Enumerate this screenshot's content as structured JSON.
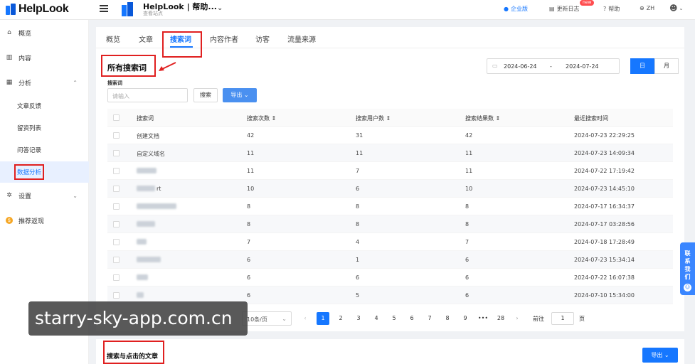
{
  "topbar": {
    "logo_text": "HelpLook",
    "site_title": "HelpLook | 帮助...",
    "site_subtitle": "查看站点",
    "enterprise": "企业版",
    "changelog": "更新日志",
    "new_badge": "new",
    "help": "帮助",
    "language": "ZH"
  },
  "sidebar": {
    "items": [
      {
        "label": "概览",
        "icon": "home-icon"
      },
      {
        "label": "内容",
        "icon": "book-icon"
      },
      {
        "label": "分析",
        "icon": "chart-icon"
      },
      {
        "label": "设置",
        "icon": "gear-icon"
      },
      {
        "label": "推荐返现",
        "icon": "coin-icon"
      }
    ],
    "sub_items": [
      "文章反馈",
      "留资列表",
      "问答记录",
      "数据分析"
    ]
  },
  "tabs": [
    "概览",
    "文章",
    "搜索词",
    "内容作者",
    "访客",
    "流量来源"
  ],
  "section": {
    "title": "所有搜索词",
    "date_start": "2024-06-24",
    "date_sep": "-",
    "date_end": "2024-07-24",
    "range_day": "日",
    "range_month": "月",
    "filter_label": "搜索词",
    "search_placeholder": "请输入",
    "search_button": "搜索",
    "export_button": "导出 ⌄"
  },
  "table": {
    "headers": [
      "搜索词",
      "搜索次数 ⇕",
      "搜索用户数 ⇕",
      "搜索结果数 ⇕",
      "最近搜索时间"
    ],
    "rows": [
      {
        "term": "创建文档",
        "count": "42",
        "users": "31",
        "results": "42",
        "time": "2024-07-23 22:29:25"
      },
      {
        "term": "自定义域名",
        "count": "11",
        "users": "11",
        "results": "11",
        "time": "2024-07-23 14:09:34"
      },
      {
        "term": "",
        "count": "11",
        "users": "7",
        "results": "11",
        "time": "2024-07-22 17:19:42"
      },
      {
        "term": "rt",
        "count": "10",
        "users": "6",
        "results": "10",
        "time": "2024-07-23 14:45:10"
      },
      {
        "term": "",
        "count": "8",
        "users": "8",
        "results": "8",
        "time": "2024-07-17 16:34:37"
      },
      {
        "term": "",
        "count": "8",
        "users": "8",
        "results": "8",
        "time": "2024-07-17 03:28:56"
      },
      {
        "term": "",
        "count": "7",
        "users": "4",
        "results": "7",
        "time": "2024-07-18 17:28:49"
      },
      {
        "term": "",
        "count": "6",
        "users": "1",
        "results": "6",
        "time": "2024-07-23 15:34:14"
      },
      {
        "term": "",
        "count": "6",
        "users": "6",
        "results": "6",
        "time": "2024-07-22 16:07:38"
      },
      {
        "term": "",
        "count": "6",
        "users": "5",
        "results": "6",
        "time": "2024-07-10 15:34:00"
      }
    ]
  },
  "pagination": {
    "page_size": "10条/页",
    "pages": [
      "1",
      "2",
      "3",
      "4",
      "5",
      "6",
      "7",
      "8",
      "9",
      "•••",
      "28"
    ],
    "prev": "‹",
    "next": "›",
    "goto_label": "前往",
    "goto_value": "1",
    "page_label": "页"
  },
  "section2": {
    "title": "搜索与点击的文章",
    "export_button": "导出 ⌄"
  },
  "contact": {
    "label": "联系我们"
  },
  "watermark": "starry-sky-app.com.cn",
  "colors": {
    "primary": "#1677ff",
    "highlight": "#e02020"
  }
}
